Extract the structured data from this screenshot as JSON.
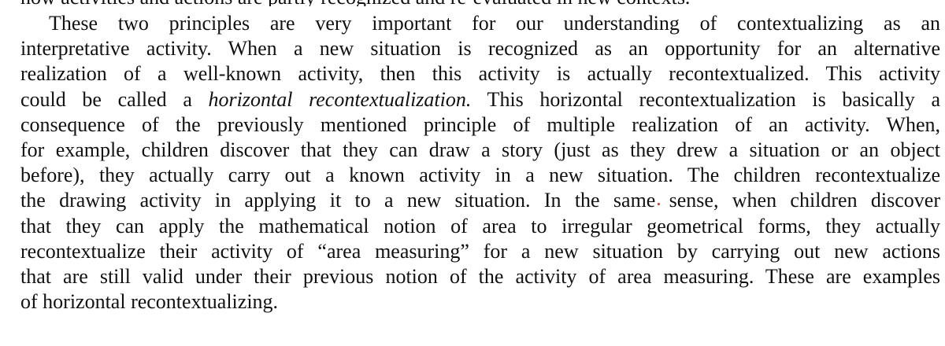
{
  "top_cut_line": "how activities and actions are partly recognized and re-evaluated in new contexts.",
  "paragraph": {
    "line_1": "These two principles are very important for our understanding of contextualizing as an",
    "line_2": "interpretative activity. When a new situation is recognized as an opportunity for an alternative",
    "line_3": "realization of a well-known activity, then this activity is actually recontextualized. This activity",
    "line_4_before": "could be called a ",
    "line_4_em": "horizontal recontextualization.",
    "line_4_after": " This horizontal recontextualization is basically a",
    "line_5": "consequence of the previously mentioned principle of multiple realization of an activity. When,",
    "line_6": "for example, children discover that they can draw a story (just as they drew a situation or an object",
    "line_7": "before), they actually carry out a known activity in a new situation. The children recontextualize",
    "line_8": "the drawing activity in applying it to a new situation. In the same sense, when children discover",
    "line_9": "that they can apply the mathematical notion of area to irregular geometrical forms, they actually",
    "line_10": "recontextualize their activity of “area measuring” for a new situation by carrying out new actions",
    "line_11": "that are still valid under their previous notion of the activity of area measuring. These are examples",
    "line_12": "of horizontal recontextualizing."
  },
  "colors": {
    "text": "#111111",
    "background": "#ffffff",
    "stray_mark": "#c0392b"
  }
}
